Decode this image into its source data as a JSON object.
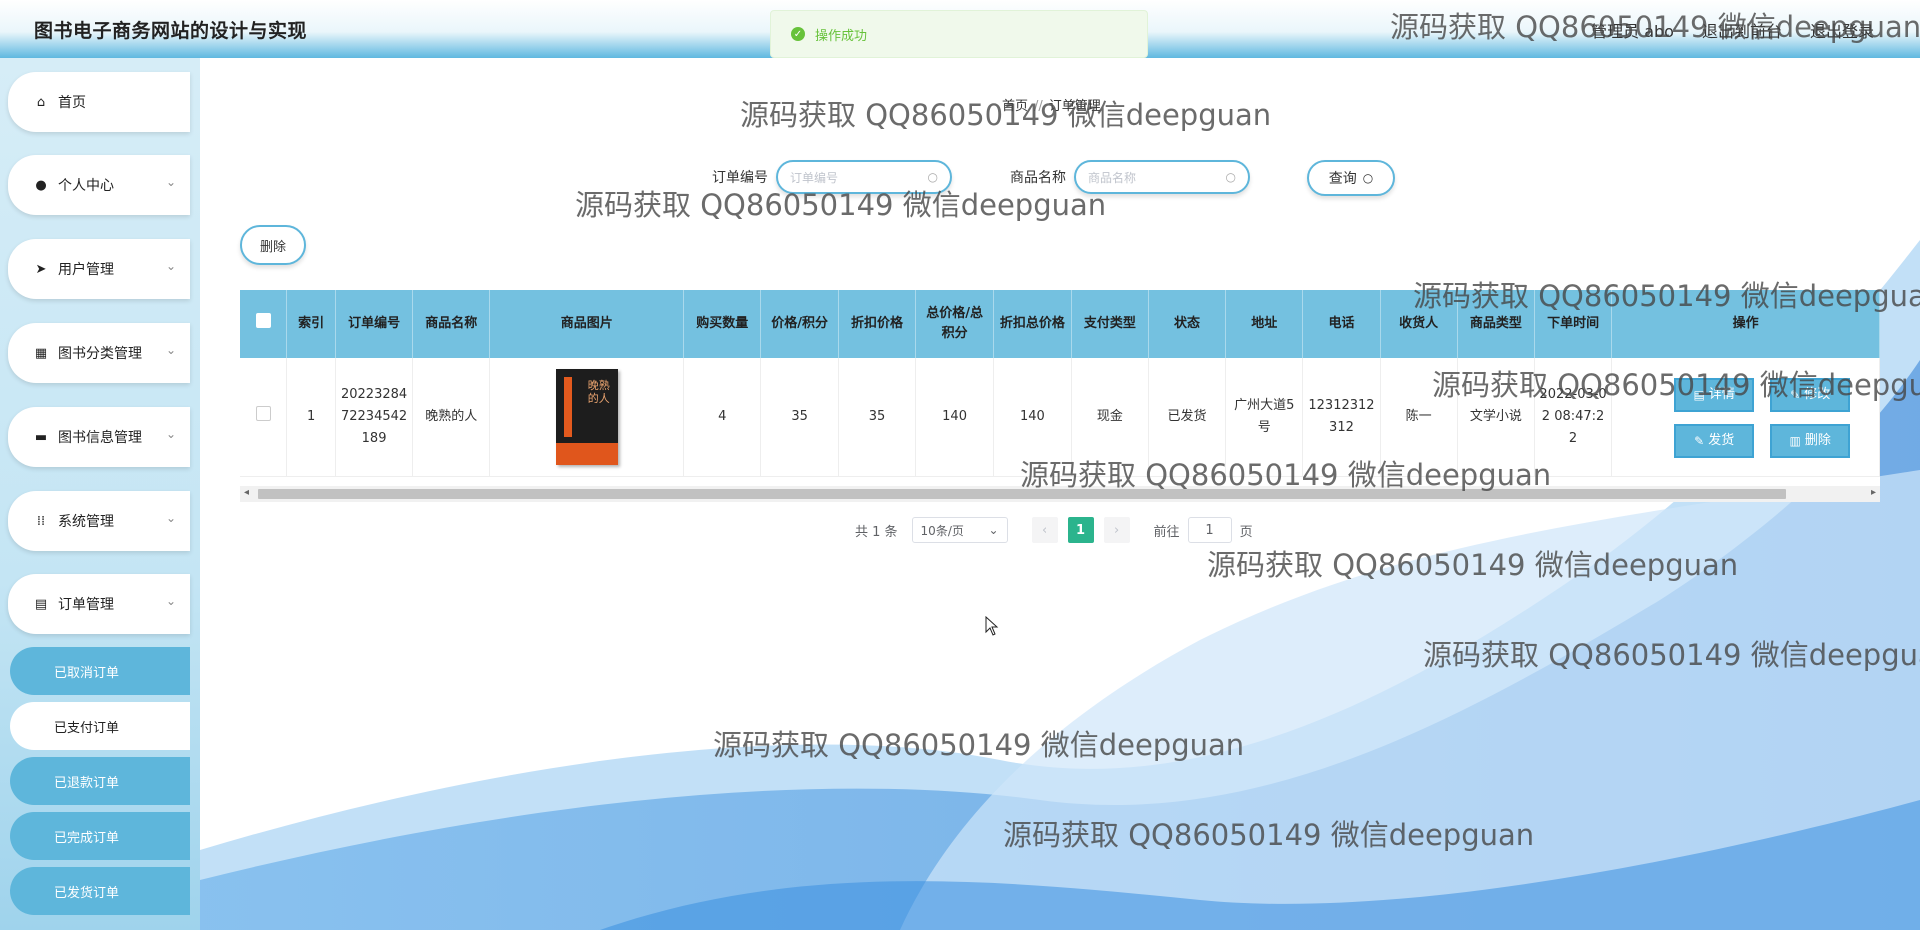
{
  "header": {
    "title": "图书电子商务网站的设计与实现",
    "admin_label": "管理员 abo",
    "front_link": "退出到前台",
    "logout_link": "退出登录"
  },
  "toast": {
    "message": "操作成功"
  },
  "sidebar": {
    "items": [
      {
        "label": "首页",
        "icon": "home-icon"
      },
      {
        "label": "个人中心",
        "icon": "user-icon"
      },
      {
        "label": "用户管理",
        "icon": "send-icon"
      },
      {
        "label": "图书分类管理",
        "icon": "grid-icon"
      },
      {
        "label": "图书信息管理",
        "icon": "briefcase-icon"
      },
      {
        "label": "系统管理",
        "icon": "apps-icon"
      },
      {
        "label": "订单管理",
        "icon": "document-icon"
      }
    ],
    "sub_items": [
      {
        "label": "已取消订单",
        "active": false
      },
      {
        "label": "已支付订单",
        "active": true
      },
      {
        "label": "已退款订单",
        "active": false
      },
      {
        "label": "已完成订单",
        "active": false
      },
      {
        "label": "已发货订单",
        "active": false
      }
    ]
  },
  "breadcrumb": {
    "home": "首页",
    "separator": "//",
    "current": "订单管理"
  },
  "search": {
    "order_no_label": "订单编号",
    "order_no_placeholder": "订单编号",
    "product_name_label": "商品名称",
    "product_name_placeholder": "商品名称",
    "query_button": "查询"
  },
  "toolbar": {
    "delete_button": "删除"
  },
  "table": {
    "columns": [
      "索引",
      "订单编号",
      "商品名称",
      "商品图片",
      "购买数量",
      "价格/积分",
      "折扣价格",
      "总价格/总积分",
      "折扣总价格",
      "支付类型",
      "状态",
      "地址",
      "电话",
      "收货人",
      "商品类型",
      "下单时间",
      "操作"
    ],
    "rows": [
      {
        "index": "1",
        "order_no": "202232847223454218​9",
        "product_name": "晚熟的人",
        "quantity": "4",
        "price": "35",
        "discount_price": "35",
        "total": "140",
        "discount_total": "140",
        "pay_type": "现金",
        "status": "已发货",
        "address": "广州大道5号",
        "phone": "12312312312",
        "receiver": "陈一",
        "category": "文学小说",
        "order_time": "2022-03-02 08:47:22",
        "book_cover_text": "晚熟的人"
      }
    ],
    "actions": {
      "detail": "详情",
      "edit": "修改",
      "ship": "发货",
      "delete": "删除"
    }
  },
  "pagination": {
    "total_text": "共 1 条",
    "page_size": "10条/页",
    "current_page": "1",
    "goto_prefix": "前往",
    "goto_value": "1",
    "goto_suffix": "页"
  },
  "watermark": "源码获取 QQ86050149 微信deepguan",
  "colors": {
    "accent": "#5eb6db",
    "header_table": "#74c1e0",
    "page_active": "#2bb48d",
    "success": "#67c23a"
  }
}
